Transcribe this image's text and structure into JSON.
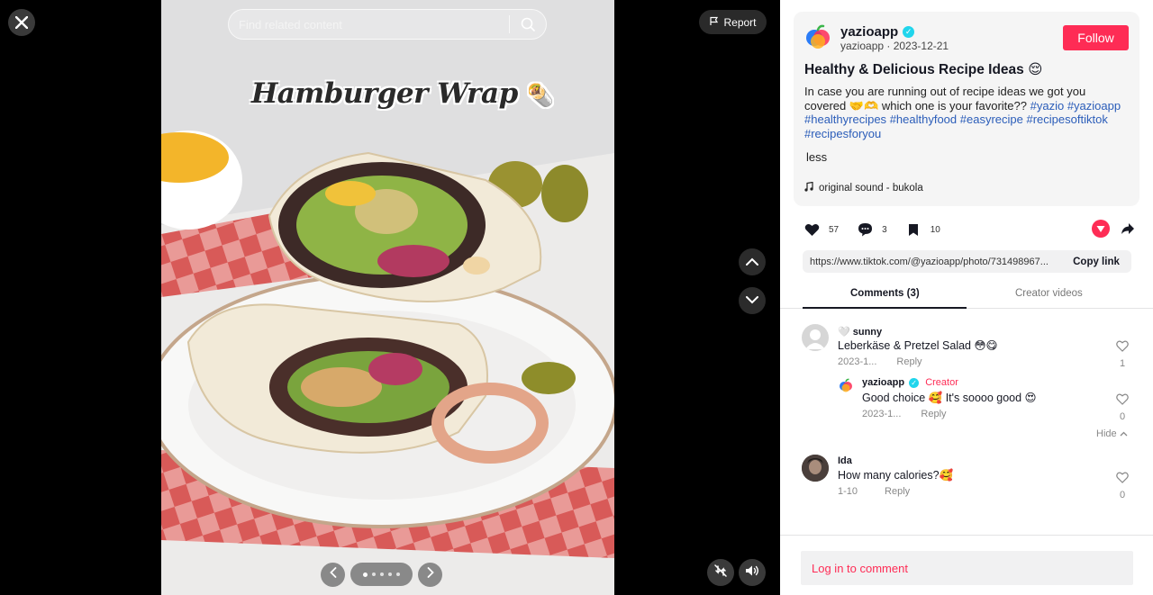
{
  "viewer": {
    "search_placeholder": "Find related content",
    "photo_title": "Hamburger Wrap",
    "photo_title_emoji": "🌯",
    "report_label": "Report",
    "carousel_count": 5,
    "carousel_active_index": 0
  },
  "post": {
    "author": "yazioapp",
    "author_meta": "yazioapp · 2023-12-21",
    "follow_label": "Follow",
    "title": "Healthy & Delicious Recipe Ideas 😌",
    "body_text": "In case you are running out of recipe ideas we got you covered 🤝🫶 which one is your favorite?? ",
    "hashtags": [
      "#yazio",
      "#yazioapp",
      "#healthyrecipes",
      "#healthyfood",
      "#easyrecipe",
      "#recipesoftiktok",
      "#recipesforyou"
    ],
    "less_label": "less",
    "sound": "original sound - bukola"
  },
  "actions": {
    "likes": "57",
    "comments": "3",
    "saves": "10"
  },
  "link": {
    "url": "https://www.tiktok.com/@yazioapp/photo/731498967...",
    "copy_label": "Copy link"
  },
  "tabs": {
    "comments": "Comments (3)",
    "creator": "Creator videos"
  },
  "comments": [
    {
      "name": "🤍 sunny",
      "text": "Leberkäse & Pretzel Salad 😳😋",
      "date": "2023-1...",
      "reply": "Reply",
      "likes": "1"
    },
    {
      "name": "yazioapp",
      "creator_tag": "Creator",
      "text": "Good choice 🥰 It's soooo good 😍",
      "date": "2023-1...",
      "reply": "Reply",
      "likes": "0"
    },
    {
      "name": "Ida",
      "text": "How many calories?🥰",
      "date": "1-10",
      "reply": "Reply",
      "likes": "0"
    }
  ],
  "hide_label": "Hide",
  "login_label": "Log in to comment",
  "colors": {
    "accent": "#fe2c55",
    "hashtag": "#2b5db9",
    "verified": "#20d5ec"
  }
}
